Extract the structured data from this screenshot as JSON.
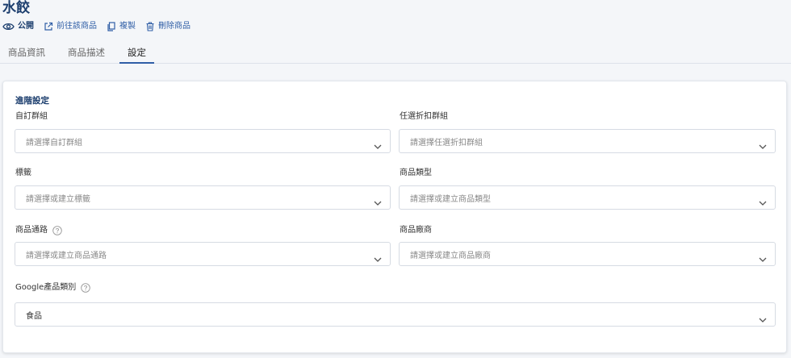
{
  "product": {
    "title": "水餃"
  },
  "actions": {
    "public": "公開",
    "goto": "前往該商品",
    "copy": "複製",
    "delete": "刪除商品"
  },
  "tabs": [
    {
      "label": "商品資訊",
      "active": false
    },
    {
      "label": "商品描述",
      "active": false
    },
    {
      "label": "設定",
      "active": true
    }
  ],
  "advanced": {
    "title": "進階設定",
    "custom_group": {
      "label": "自訂群組",
      "placeholder": "請選擇自訂群組"
    },
    "discount_group": {
      "label": "任選折扣群組",
      "placeholder": "請選擇任選折扣群組"
    },
    "tags": {
      "label": "標籤",
      "placeholder": "請選擇或建立標籤"
    },
    "product_type": {
      "label": "商品類型",
      "placeholder": "請選擇或建立商品類型"
    },
    "channel": {
      "label": "商品通路",
      "placeholder": "請選擇或建立商品通路"
    },
    "vendor": {
      "label": "商品廠商",
      "placeholder": "請選擇或建立商品廠商"
    },
    "google_category": {
      "label": "Google產品類別",
      "value": "食品"
    }
  },
  "colors": {
    "primary": "#2f5ea6",
    "title": "#1c3e6e",
    "background": "#f4f6f9"
  }
}
